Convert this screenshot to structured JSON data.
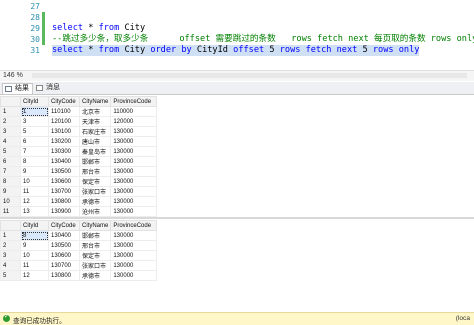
{
  "editor": {
    "line_numbers": [
      "27",
      "28",
      "29",
      "30",
      "31"
    ],
    "lines": [
      {
        "parts": []
      },
      {
        "parts": []
      },
      {
        "parts": [
          {
            "t": "select",
            "k": "kw"
          },
          {
            "t": " * ",
            "k": ""
          },
          {
            "t": "from",
            "k": "kw"
          },
          {
            "t": " City",
            "k": ""
          }
        ]
      },
      {
        "parts": [
          {
            "t": "--跳过多少条，取多少条      offset 需要跳过的条数   rows fetch next 每页取的条数 rows only",
            "k": "cm"
          }
        ]
      },
      {
        "parts": [
          {
            "t": "select",
            "k": "kw"
          },
          {
            "t": " * ",
            "k": ""
          },
          {
            "t": "from",
            "k": "kw"
          },
          {
            "t": " City ",
            "k": ""
          },
          {
            "t": "order by",
            "k": "kw"
          },
          {
            "t": " CityId ",
            "k": ""
          },
          {
            "t": "offset",
            "k": "kw"
          },
          {
            "t": " 5 ",
            "k": ""
          },
          {
            "t": "rows fetch next",
            "k": "kw"
          },
          {
            "t": " 5 ",
            "k": ""
          },
          {
            "t": "rows only",
            "k": "kw"
          }
        ]
      }
    ]
  },
  "zoom": {
    "value": "146 %"
  },
  "tabs": {
    "results": "结果",
    "messages": "消息"
  },
  "grid1": {
    "columns": [
      "CityId",
      "CityCode",
      "CityName",
      "ProvinceCode"
    ],
    "rows": [
      [
        "1",
        "1",
        "110100",
        "北京市",
        "110000"
      ],
      [
        "2",
        "3",
        "120100",
        "天津市",
        "120000"
      ],
      [
        "3",
        "5",
        "130100",
        "石家庄市",
        "130000"
      ],
      [
        "4",
        "6",
        "130200",
        "唐山市",
        "130000"
      ],
      [
        "5",
        "7",
        "130300",
        "秦皇岛市",
        "130000"
      ],
      [
        "6",
        "8",
        "130400",
        "邯郸市",
        "130000"
      ],
      [
        "7",
        "9",
        "130500",
        "邢台市",
        "130000"
      ],
      [
        "8",
        "10",
        "130600",
        "保定市",
        "130000"
      ],
      [
        "9",
        "11",
        "130700",
        "张家口市",
        "130000"
      ],
      [
        "10",
        "12",
        "130800",
        "承德市",
        "130000"
      ],
      [
        "11",
        "13",
        "130900",
        "沧州市",
        "130000"
      ]
    ]
  },
  "grid2": {
    "columns": [
      "CityId",
      "CityCode",
      "CityName",
      "ProvinceCode"
    ],
    "rows": [
      [
        "1",
        "8",
        "130400",
        "邯郸市",
        "130000"
      ],
      [
        "2",
        "9",
        "130500",
        "邢台市",
        "130000"
      ],
      [
        "3",
        "10",
        "130600",
        "保定市",
        "130000"
      ],
      [
        "4",
        "11",
        "130700",
        "张家口市",
        "130000"
      ],
      [
        "5",
        "12",
        "130800",
        "承德市",
        "130000"
      ]
    ]
  },
  "status": {
    "message": "查询已成功执行。",
    "server": "(loca"
  }
}
